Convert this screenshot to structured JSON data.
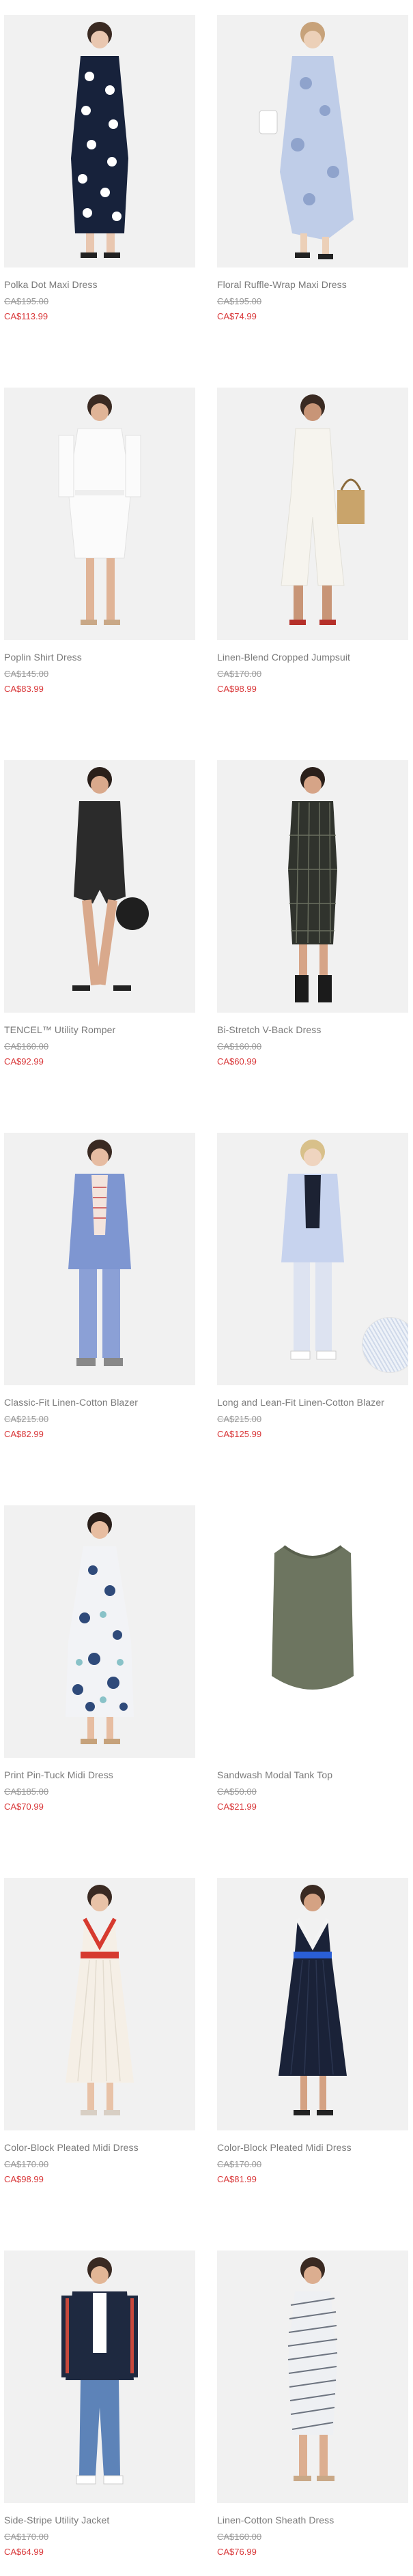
{
  "products": [
    {
      "name": "Polka Dot Maxi Dress",
      "original_price": "CA$195.00",
      "sale_price": "CA$113.99"
    },
    {
      "name": "Floral Ruffle-Wrap Maxi Dress",
      "original_price": "CA$195.00",
      "sale_price": "CA$74.99"
    },
    {
      "name": "Poplin Shirt Dress",
      "original_price": "CA$145.00",
      "sale_price": "CA$83.99"
    },
    {
      "name": "Linen-Blend Cropped Jumpsuit",
      "original_price": "CA$170.00",
      "sale_price": "CA$98.99"
    },
    {
      "name": "TENCEL™ Utility Romper",
      "original_price": "CA$160.00",
      "sale_price": "CA$92.99"
    },
    {
      "name": "Bi-Stretch V-Back Dress",
      "original_price": "CA$160.00",
      "sale_price": "CA$60.99"
    },
    {
      "name": "Classic-Fit Linen-Cotton Blazer",
      "original_price": "CA$215.00",
      "sale_price": "CA$82.99"
    },
    {
      "name": "Long and Lean-Fit Linen-Cotton Blazer",
      "original_price": "CA$215.00",
      "sale_price": "CA$125.99"
    },
    {
      "name": "Print Pin-Tuck Midi Dress",
      "original_price": "CA$185.00",
      "sale_price": "CA$70.99"
    },
    {
      "name": "Sandwash Modal Tank Top",
      "original_price": "CA$50.00",
      "sale_price": "CA$21.99"
    },
    {
      "name": "Color-Block Pleated Midi Dress",
      "original_price": "CA$170.00",
      "sale_price": "CA$98.99"
    },
    {
      "name": "Color-Block Pleated Midi Dress",
      "original_price": "CA$170.00",
      "sale_price": "CA$81.99"
    },
    {
      "name": "Side-Stripe Utility Jacket",
      "original_price": "CA$170.00",
      "sale_price": "CA$64.99"
    },
    {
      "name": "Linen-Cotton Sheath Dress",
      "original_price": "CA$160.00",
      "sale_price": "CA$76.99"
    }
  ],
  "colors": {
    "sale_price": "#d9383a",
    "photo_background": "#f1f1f1"
  },
  "images": [
    "polka-dot-dress-photo",
    "floral-wrap-dress-photo",
    "white-shirt-dress-photo",
    "white-jumpsuit-photo",
    "black-romper-photo",
    "plaid-sheath-dress-photo",
    "blue-blazer-photo",
    "light-blue-blazer-photo",
    "floral-midi-dress-photo",
    "olive-tank-top-photo",
    "white-pleated-dress-photo",
    "navy-pleated-dress-photo",
    "navy-utility-jacket-photo",
    "striped-sheath-dress-photo"
  ]
}
